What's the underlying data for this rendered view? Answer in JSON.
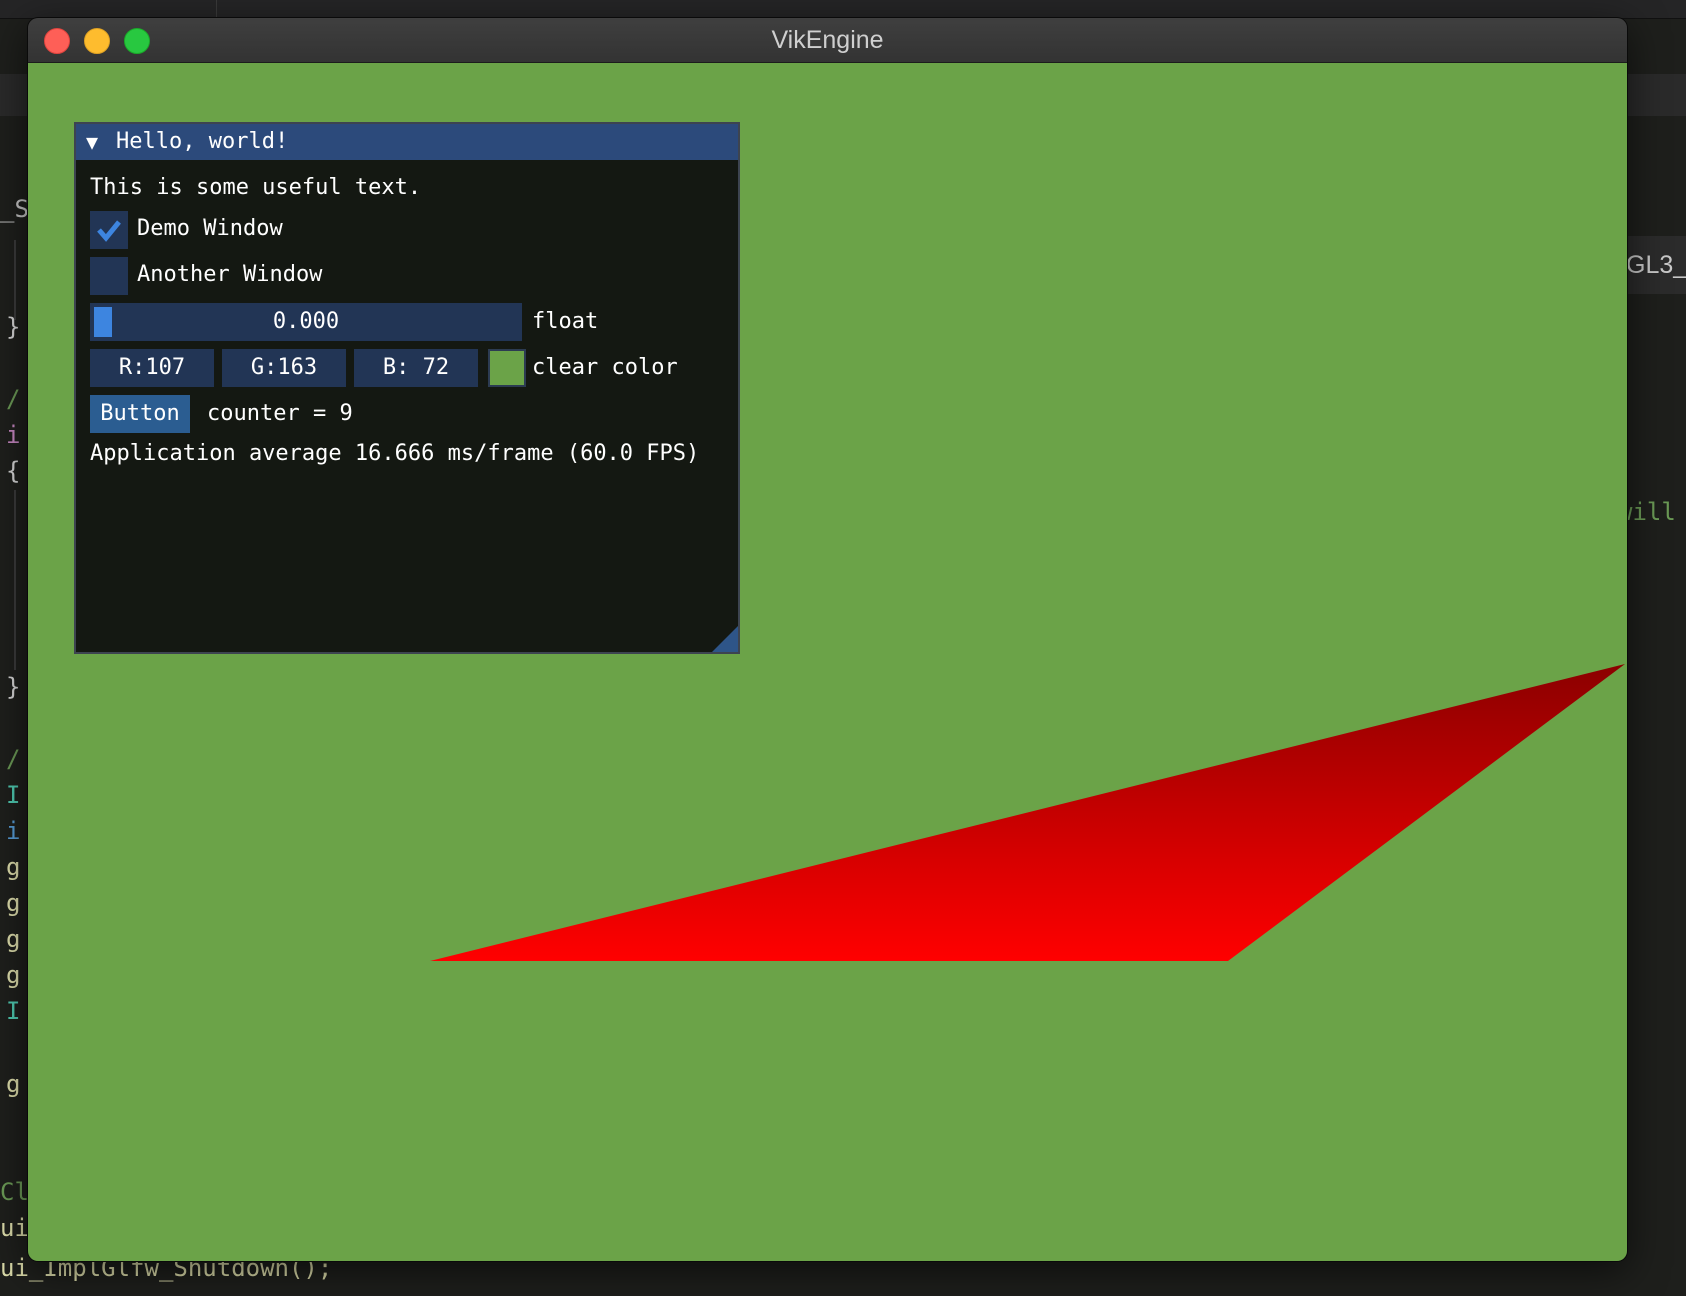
{
  "window": {
    "title": "VikEngine"
  },
  "imgui_window": {
    "title": "Hello, world!",
    "collapse_arrow": "▼",
    "text": "This is some useful text.",
    "checkboxes": [
      {
        "label": "Demo Window",
        "checked": true
      },
      {
        "label": "Another Window",
        "checked": false
      }
    ],
    "slider": {
      "value_text": "0.000",
      "value": 0.0,
      "label": "float"
    },
    "color_edit": {
      "r": "R:107",
      "g": "G:163",
      "b": "B: 72",
      "label": "clear color",
      "swatch_color": "#6ba348"
    },
    "button": {
      "label": "Button"
    },
    "counter_text": "counter = 9",
    "fps_text": "Application average 16.666 ms/frame (60.0 FPS)"
  },
  "scene": {
    "clear_color": "#6ba348",
    "triangle_colors": {
      "top": "#8b0000",
      "bottom": "#ff0000"
    }
  },
  "background_editor": {
    "left_fragments": [
      "_S",
      "}",
      "/",
      "i",
      "{",
      "}",
      "/",
      "I",
      "i",
      "g",
      "g",
      "g",
      "g",
      "I",
      "g",
      "Cl",
      "ui",
      "ui_ImplGlfw_Shutdown();"
    ],
    "right_fragments": [
      "GL3_",
      "will"
    ]
  }
}
